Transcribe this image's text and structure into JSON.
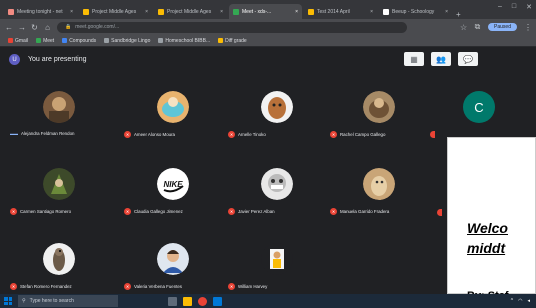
{
  "browser": {
    "tabs": [
      {
        "title": "Meeting tonight - net",
        "color": "#f28b82",
        "active": false
      },
      {
        "title": "Project Middle Ages",
        "color": "#fbbc04",
        "active": false
      },
      {
        "title": "Project Middle Ages",
        "color": "#fbbc04",
        "active": false
      },
      {
        "title": "Meet - xds-...",
        "color": "#34a853",
        "active": true
      },
      {
        "title": "Test 2014 April",
        "color": "#fbbc04",
        "active": false
      },
      {
        "title": "Beeup - Schoology",
        "color": "#ffffff",
        "active": false
      }
    ],
    "new_tab": "+",
    "url": "meet.google.com/...",
    "paused_label": "Paused",
    "bookmarks": [
      {
        "label": "Gmail",
        "color": "#ea4335"
      },
      {
        "label": "Meet",
        "color": "#34a853"
      },
      {
        "label": "Compounds",
        "color": "#4285f4"
      },
      {
        "label": "Sandbridge Lingo",
        "color": "#9aa0a6"
      },
      {
        "label": "Homeschool BIBB...",
        "color": "#9aa0a6"
      },
      {
        "label": "Diff grade",
        "color": "#fbbc04"
      }
    ]
  },
  "meet": {
    "presenting_text": "You are presenting",
    "presenter_initial": "U",
    "participants": [
      {
        "name": "Alejandra Feldman Rendon",
        "bg": "#6b4f3a",
        "muted": false
      },
      {
        "name": "Ameer Alonso Moura",
        "bg": "#d9a067",
        "muted": true
      },
      {
        "name": "Arnelle Tinoko",
        "bg": "#c8864d",
        "muted": true
      },
      {
        "name": "Rachel Campo Gallego",
        "bg": "#8b6b4a",
        "muted": true
      },
      {
        "name": "Carmen Santiago Romero",
        "bg": "#5a6b3a",
        "muted": true
      },
      {
        "name": "Claudia Gallego Jimenez",
        "bg": "#f5f5f5",
        "muted": true
      },
      {
        "name": "Javier Perez Alban",
        "bg": "#e0e0e0",
        "muted": true
      },
      {
        "name": "Manuela Garrido Fradera",
        "bg": "#c9a577",
        "muted": true
      },
      {
        "name": "Stefan Romero Fernandez",
        "bg": "#f0f0f0",
        "muted": true
      },
      {
        "name": "Valeria Verbena Fuentes",
        "bg": "#dfe6ef",
        "muted": true
      },
      {
        "name": "William Harvey",
        "bg": "#202124",
        "muted": true
      }
    ],
    "extra_participant_initial": "C",
    "extra_participant_color": "#00796b"
  },
  "slide": {
    "title_line1": "Welco",
    "title_line2": "middt",
    "by": "By: Stef"
  },
  "taskbar": {
    "search_placeholder": "Type here to search"
  }
}
